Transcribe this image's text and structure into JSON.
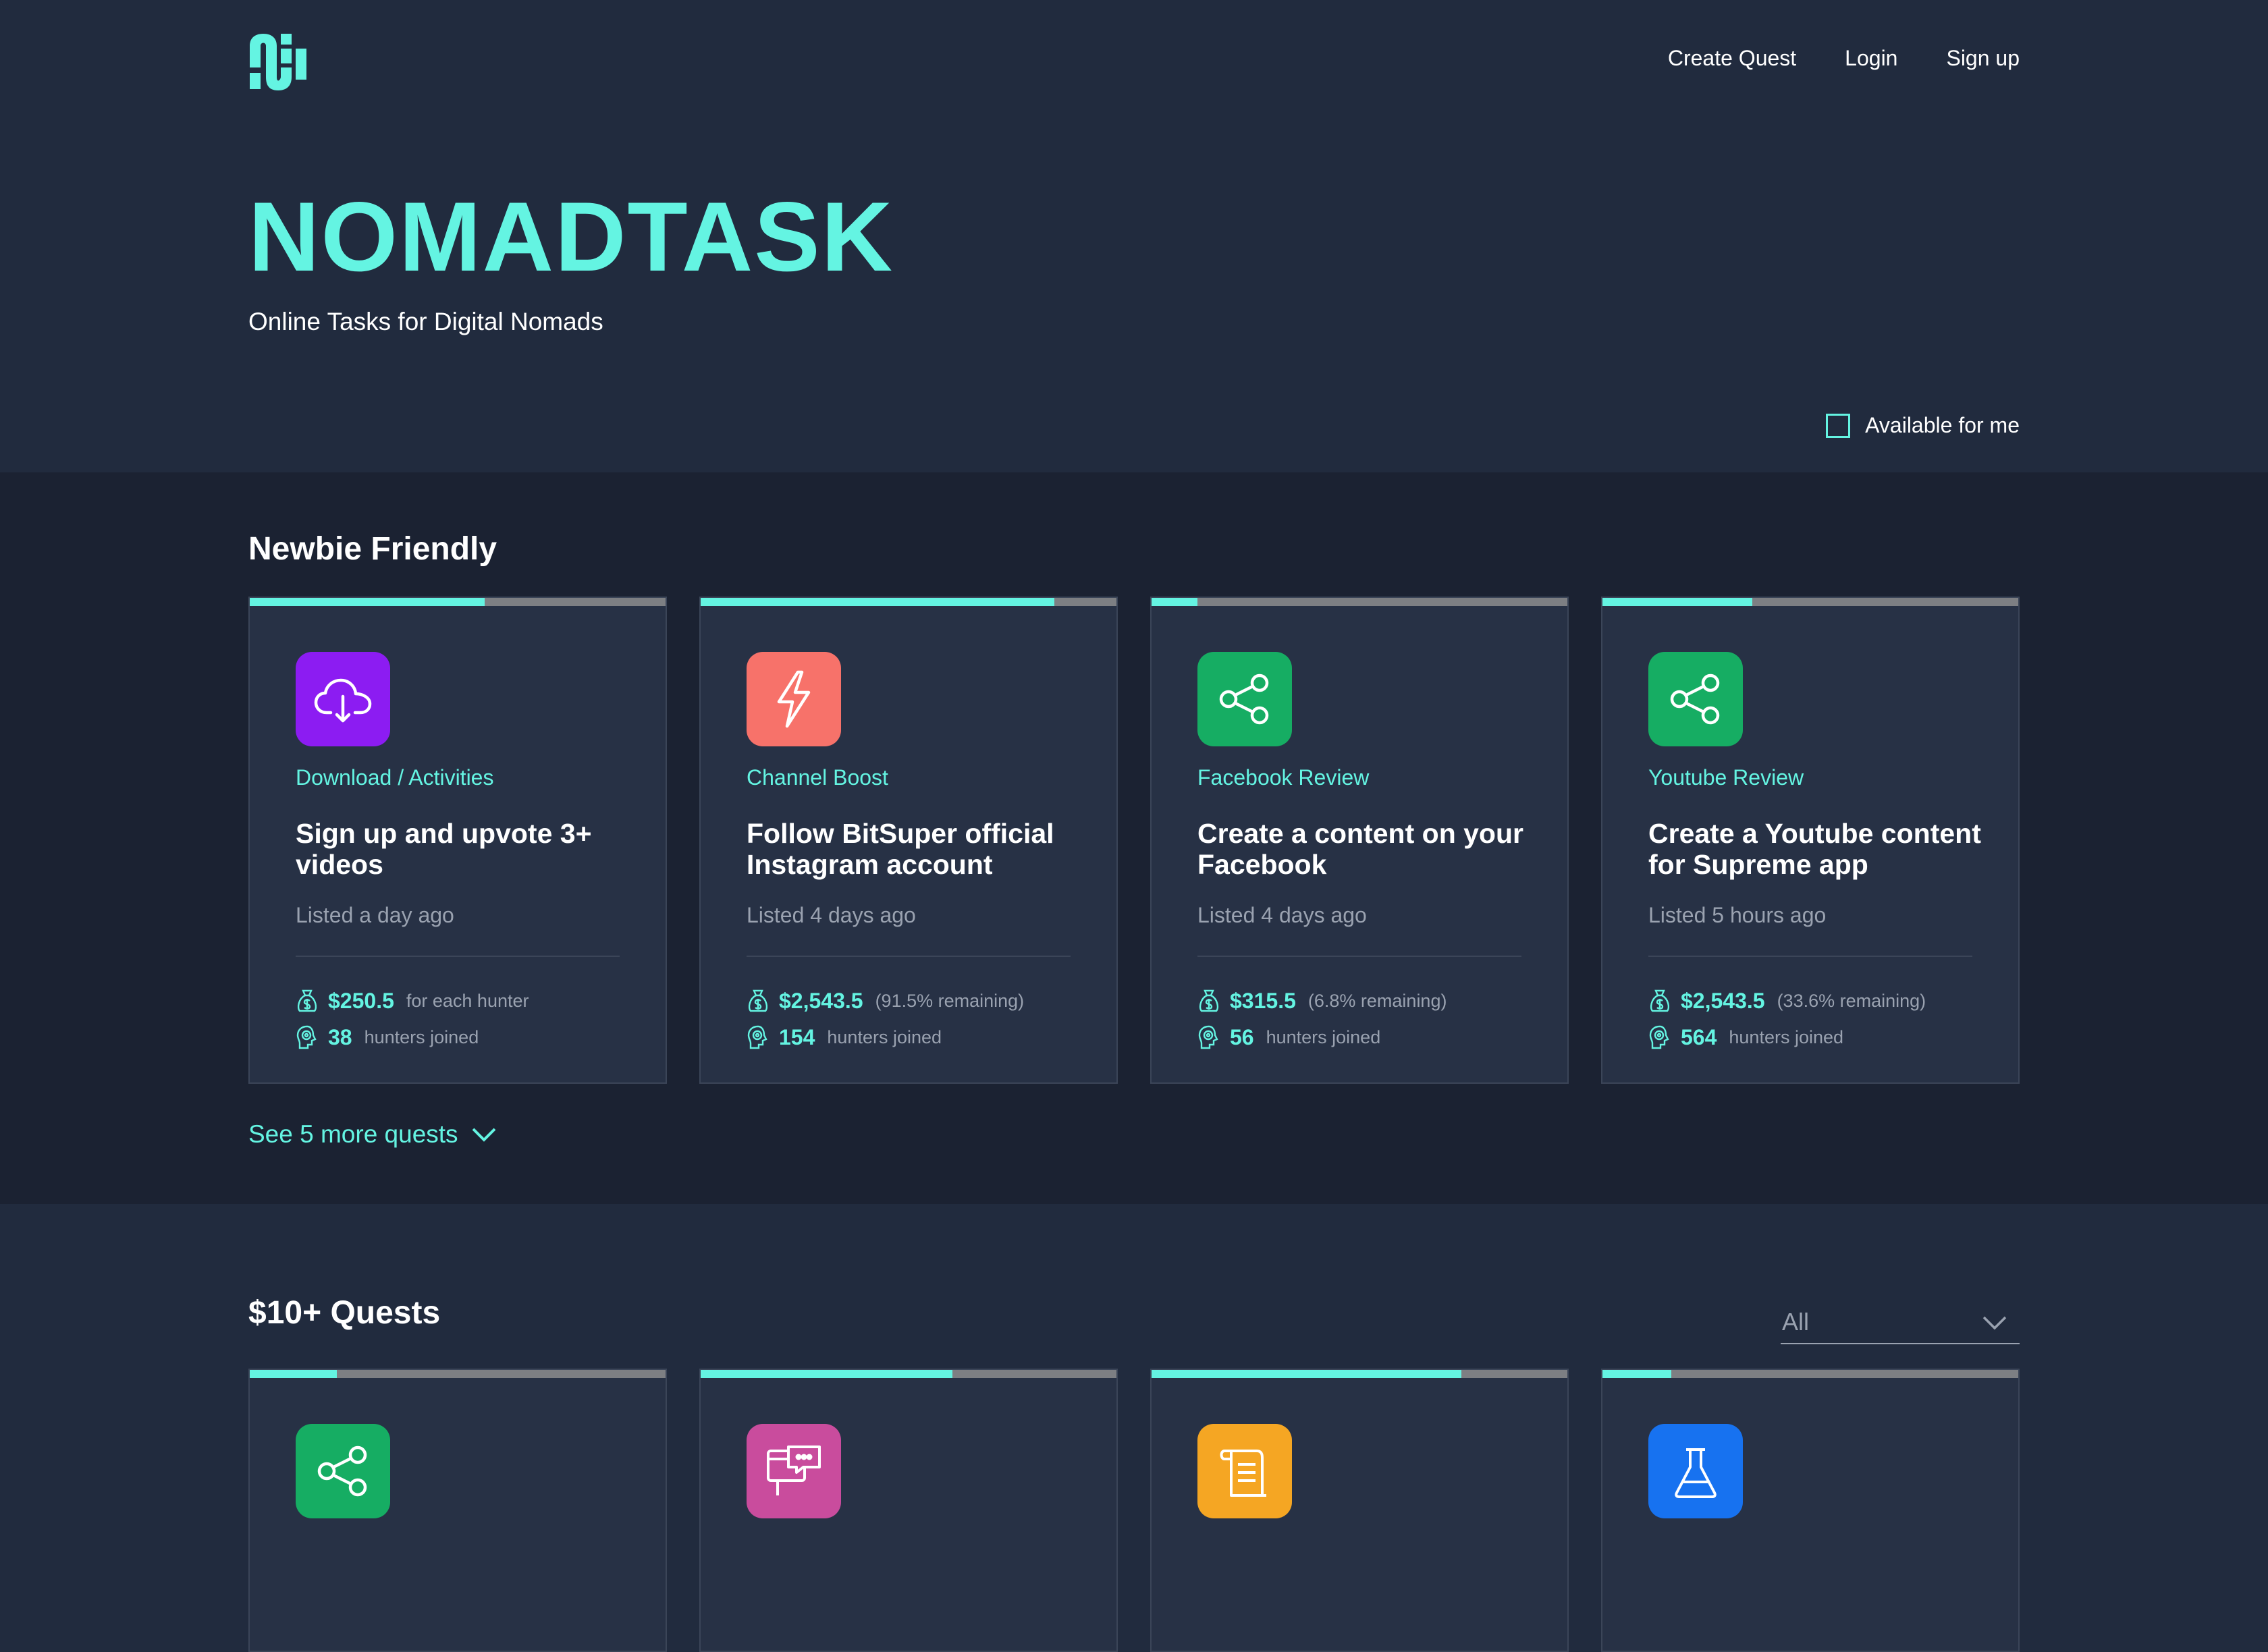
{
  "nav": {
    "create_quest": "Create Quest",
    "login": "Login",
    "signup": "Sign up"
  },
  "hero": {
    "title": "NOMADTASK",
    "subtitle": "Online Tasks for Digital Nomads"
  },
  "filter": {
    "available_label": "Available for me",
    "checked": false
  },
  "newbie": {
    "title": "Newbie Friendly",
    "see_more": "See 5 more quests",
    "cards": [
      {
        "progress": 0.565,
        "icon": "cloud-download-icon",
        "icon_bg": "#8c1cf2",
        "category": "Download / Activities",
        "title": "Sign up and upvote 3+ videos",
        "listed": "Listed a day ago",
        "amount": "$250.5",
        "amount_note": "for each hunter",
        "hunters": "38",
        "hunters_label": "hunters joined"
      },
      {
        "progress": 0.85,
        "icon": "lightning-icon",
        "icon_bg": "#f7726a",
        "category": "Channel Boost",
        "title": "Follow BitSuper official Instagram account",
        "listed": "Listed 4 days ago",
        "amount": "$2,543.5",
        "amount_note": "(91.5% remaining)",
        "hunters": "154",
        "hunters_label": "hunters joined"
      },
      {
        "progress": 0.11,
        "icon": "share-icon",
        "icon_bg": "#16ad63",
        "category": "Facebook Review",
        "title": "Create a content on your Facebook",
        "listed": "Listed 4 days ago",
        "amount": "$315.5",
        "amount_note": "(6.8% remaining)",
        "hunters": "56",
        "hunters_label": "hunters joined"
      },
      {
        "progress": 0.36,
        "icon": "share-icon",
        "icon_bg": "#16ad63",
        "category": "Youtube Review",
        "title": "Create a Youtube content for Supreme app",
        "listed": "Listed 5 hours ago",
        "amount": "$2,543.5",
        "amount_note": "(33.6% remaining)",
        "hunters": "564",
        "hunters_label": "hunters joined"
      }
    ]
  },
  "quests": {
    "title": "$10+ Quests",
    "select_value": "All",
    "cards": [
      {
        "progress": 0.21,
        "icon": "share-icon",
        "icon_bg": "#16ad63"
      },
      {
        "progress": 0.605,
        "icon": "chat-window-icon",
        "icon_bg": "#c94c9d"
      },
      {
        "progress": 0.745,
        "icon": "scroll-icon",
        "icon_bg": "#f5a623"
      },
      {
        "progress": 0.165,
        "icon": "flask-icon",
        "icon_bg": "#1772f0"
      }
    ]
  }
}
